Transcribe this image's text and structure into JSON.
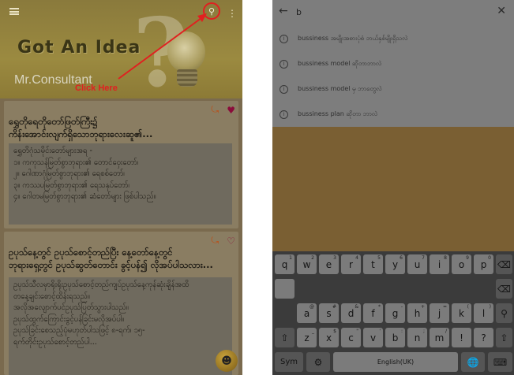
{
  "left_screen": {
    "hero": {
      "banner_text": "Got An Idea",
      "decorative_mark": "?",
      "brand": "Mr.Consultant",
      "annotation": "Click Here"
    },
    "cards": [
      {
        "title": "ရွှေတိုရေတိုတော်ဖြတ်ကြီး၌\nကိန်းအောင်းလျက်ရှိသောဘုရားလေးဆူ၏...",
        "body": "ရွှေတိဂုံသမိုင်းတော်များအရ -\n၁။ ကကုသန်မြတ်စွာဘုရား၏ တောင်ဝှေးတော်၊\n၂။ ဂေါဏာဂုံမြတ်စွာဘုရား၏ ရေစစ်တော်၊\n၃။ ကဿပမြတ်စွာဘုရား၏ ရေသနုပ်တော်၊\n၄။ ဂေါတမမြတ်စွာဘုရား၏ ဆံတော်များ ဖြစ်ပါသည်။",
        "liked": true
      },
      {
        "title": "ဥပုသ်နေ့တွင် ဥပုသ်စောင့်တည်ပြီး နေ့တော်နေ့တွင်\nဘုရားရှေ့တွင် ဥပုသ်ဆွတ်တောင်း ခွင့်ပန်၍ လိုအပ်ပါသလား...",
        "body": "ဥပုသ်သီလမှာရိုးရိုးဥပုသ်စောင့်တည်ကျပ်ဥပုသ်နေ့ကုန်ဆုံးချိန်အထိ\nတနေ့ချင်းစောင့်ထိန်းရသည်။\nအလိုအလျောက်ပင်ဥပုသ်ပြတ်သွားပါသည်။\nဥပုသ်ထွက်ကြောင်းခွင့်ပန်ခြင်းမလိုအပ်ပါ။\nဥပုသ်ခြင်းစေသည့်ပုံမဟုတ်ပါသဖြင့် ၈-ရက်၊ ၁၅-\nရက်တိုင်းဥပုသ်စောင့်တည်ပါ..."
      }
    ]
  },
  "right_screen": {
    "search": {
      "query": "b"
    },
    "suggestions": [
      "bussiness အမျိုးအစားပုံစံ ဘယ်နှစ်မျိုးရှိသလဲ",
      "bussiness model ဆိုတာဘာလဲ",
      "bussiness model မှ ဘာတွေလဲ",
      "bussiness plan ဆိုတာ ဘာလဲ"
    ],
    "keyboard": {
      "row1": [
        {
          "k": "q",
          "s": "1"
        },
        {
          "k": "w",
          "s": "2"
        },
        {
          "k": "e",
          "s": "3"
        },
        {
          "k": "r",
          "s": "4"
        },
        {
          "k": "t",
          "s": "5"
        },
        {
          "k": "y",
          "s": "6"
        },
        {
          "k": "u",
          "s": "7"
        },
        {
          "k": "i",
          "s": "8"
        },
        {
          "k": "o",
          "s": "9"
        },
        {
          "k": "p",
          "s": "0"
        }
      ],
      "row2": [
        {
          "k": "a",
          "s": "@"
        },
        {
          "k": "s",
          "s": "#"
        },
        {
          "k": "d",
          "s": "&"
        },
        {
          "k": "f",
          "s": "*"
        },
        {
          "k": "g",
          "s": "-"
        },
        {
          "k": "h",
          "s": "+"
        },
        {
          "k": "j",
          "s": "="
        },
        {
          "k": "k",
          "s": "("
        },
        {
          "k": "l",
          "s": ")"
        }
      ],
      "row3": [
        {
          "k": "z",
          "s": "_"
        },
        {
          "k": "x",
          "s": "$"
        },
        {
          "k": "c",
          "s": "\""
        },
        {
          "k": "v",
          "s": "'"
        },
        {
          "k": "b",
          "s": ":"
        },
        {
          "k": "n",
          "s": ";"
        },
        {
          "k": "m",
          "s": "/"
        },
        {
          "k": "!",
          "s": ""
        },
        {
          "k": "?",
          "s": ""
        }
      ],
      "sym_label": "Sym",
      "language_label": "English(UK)"
    }
  }
}
